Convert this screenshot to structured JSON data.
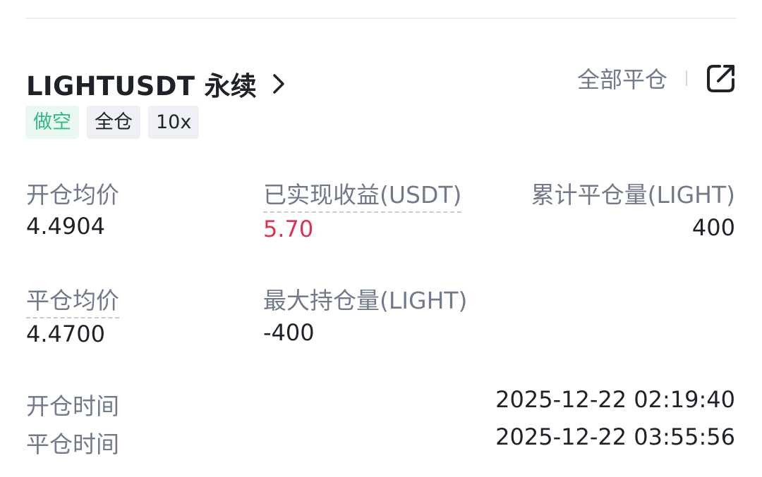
{
  "header": {
    "symbol": "LIGHTUSDT 永续",
    "close_all_label": "全部平仓"
  },
  "tags": [
    "做空",
    "全仓",
    "10x"
  ],
  "stats": {
    "avg_open_price_label": "开仓均价",
    "avg_open_price": "4.4904",
    "realized_pnl_label": "已实现收益(USDT)",
    "realized_pnl": "5.70",
    "cum_closed_label": "累计平仓量(LIGHT)",
    "cum_closed": "400",
    "avg_close_price_label": "平仓均价",
    "avg_close_price": "4.4700",
    "max_position_label": "最大持仓量(LIGHT)",
    "max_position": "-400"
  },
  "times": {
    "open_label": "开仓时间",
    "open_time": "2025-12-22 02:19:40",
    "close_label": "平仓时间",
    "close_time": "2025-12-22 03:55:56"
  },
  "colors": {
    "short_green": "#2ebd85",
    "pnl_red": "#e0304f",
    "muted": "#707a8a"
  },
  "icons": [
    "chevron-right-icon",
    "share-icon"
  ]
}
